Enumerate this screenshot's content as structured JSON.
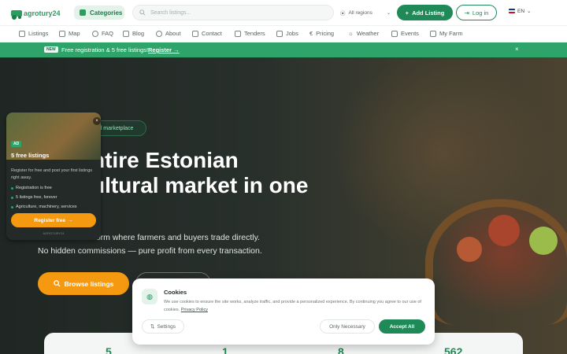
{
  "header": {
    "logo_text": "agrotury24",
    "categories_label": "Categories",
    "search_placeholder": "Search listings...",
    "region_label": "All regions",
    "add_listing_label": "Add Listing",
    "login_label": "Log in",
    "lang_label": "EN"
  },
  "nav": {
    "items": [
      {
        "label": "Listings",
        "icon": "listings-icon"
      },
      {
        "label": "Map",
        "icon": "map-icon"
      },
      {
        "label": "FAQ",
        "icon": "faq-icon"
      },
      {
        "label": "Blog",
        "icon": "blog-icon"
      },
      {
        "label": "About",
        "icon": "info-icon"
      },
      {
        "label": "Contact",
        "icon": "mail-icon"
      },
      {
        "label": "Tenders",
        "icon": "document-icon"
      },
      {
        "label": "Jobs",
        "icon": "briefcase-icon"
      },
      {
        "label": "Pricing",
        "icon": "euro-icon"
      },
      {
        "label": "Weather",
        "icon": "weather-icon"
      },
      {
        "label": "Events",
        "icon": "calendar-icon"
      },
      {
        "label": "My Farm",
        "icon": "farm-icon"
      }
    ]
  },
  "banner": {
    "badge": "NEW",
    "text": "Free registration & 5 free listings!",
    "link": "Register →",
    "close": "×"
  },
  "hero": {
    "tag": "nal marketplace",
    "title_line1": "ntire Estonian",
    "title_line2": "ultural market in one",
    "sub_line1": "tform where farmers and buyers trade directly.",
    "sub_line2": "No hidden commissions — pure profit from every transaction.",
    "browse_label": "Browse listings",
    "stats": [
      "5",
      "1",
      "8",
      "562"
    ]
  },
  "ad": {
    "badge": "AD",
    "title": "5 free listings",
    "description": "Register for free and post your first listings right away.",
    "bullets": [
      "Registration is free",
      "5 listings free, forever",
      "Agriculture, machinery, services"
    ],
    "button": "Register free",
    "footer": "AGROTURY24"
  },
  "cookie": {
    "title": "Cookies",
    "text": "We use cookies to ensure the site works, analyze traffic, and provide a personalized experience. By continuing you agree to our use of cookies.",
    "policy_link": "Privacy Policy",
    "settings_label": "Settings",
    "only_necessary_label": "Only Necessary",
    "accept_label": "Accept All"
  },
  "colors": {
    "brand_green": "#1f8a57",
    "banner_green": "#2ea36a",
    "accent_orange": "#f59a10"
  }
}
